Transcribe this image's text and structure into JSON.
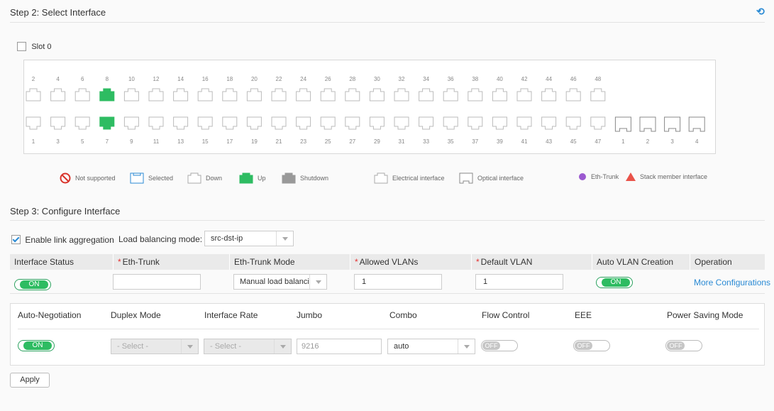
{
  "step2": {
    "title": "Step 2: Select Interface",
    "refresh_icon": "refresh-icon"
  },
  "slot": {
    "label": "Slot 0",
    "checked": false
  },
  "ports": {
    "top_numbers": [
      "2",
      "4",
      "6",
      "8",
      "10",
      "12",
      "14",
      "16",
      "18",
      "20",
      "22",
      "24",
      "26",
      "28",
      "30",
      "32",
      "34",
      "36",
      "38",
      "40",
      "42",
      "44",
      "46",
      "48"
    ],
    "bottom_numbers": [
      "1",
      "3",
      "5",
      "7",
      "9",
      "11",
      "13",
      "15",
      "17",
      "19",
      "21",
      "23",
      "25",
      "27",
      "29",
      "31",
      "33",
      "35",
      "37",
      "39",
      "41",
      "43",
      "45",
      "47"
    ],
    "optical_numbers": [
      "1",
      "2",
      "3",
      "4"
    ],
    "up_ports": [
      "7",
      "8"
    ],
    "colors": {
      "up": "#2ebc62",
      "down_border": "#bbbbbb",
      "selected_border": "#2a8ad4",
      "shutdown": "#999999"
    }
  },
  "legend": {
    "not_supported": "Not supported",
    "selected": "Selected",
    "down": "Down",
    "up": "Up",
    "shutdown": "Shutdown",
    "electrical": "Electrical interface",
    "optical": "Optical interface",
    "eth_trunk": "Eth-Trunk",
    "stack_member": "Stack member interface"
  },
  "step3": {
    "title": "Step 3: Configure Interface",
    "enable_link_aggregation": "Enable link aggregation",
    "link_aggregation_checked": true,
    "load_balancing_label": "Load balancing mode:",
    "load_balancing_value": "src-dst-ip"
  },
  "table": {
    "headers": {
      "interface_status": "Interface Status",
      "eth_trunk": "Eth-Trunk",
      "eth_trunk_mode": "Eth-Trunk Mode",
      "allowed_vlans": "Allowed VLANs",
      "default_vlan": "Default VLAN",
      "auto_vlan_creation": "Auto VLAN Creation",
      "operation": "Operation"
    },
    "row": {
      "interface_status": "ON",
      "eth_trunk": "",
      "eth_trunk_mode": "Manual load balanci",
      "allowed_vlans": "1",
      "default_vlan": "1",
      "auto_vlan_creation": "ON",
      "operation": "More Configurations"
    }
  },
  "advanced": {
    "headers": {
      "auto_negotiation": "Auto-Negotiation",
      "duplex_mode": "Duplex Mode",
      "interface_rate": "Interface Rate",
      "jumbo": "Jumbo",
      "combo": "Combo",
      "flow_control": "Flow Control",
      "eee": "EEE",
      "power_saving": "Power Saving Mode"
    },
    "values": {
      "auto_negotiation": "ON",
      "duplex_mode": "- Select -",
      "interface_rate": "- Select -",
      "jumbo": "9216",
      "combo": "auto",
      "flow_control": "OFF",
      "eee": "OFF",
      "power_saving": "OFF"
    }
  },
  "apply_label": "Apply"
}
